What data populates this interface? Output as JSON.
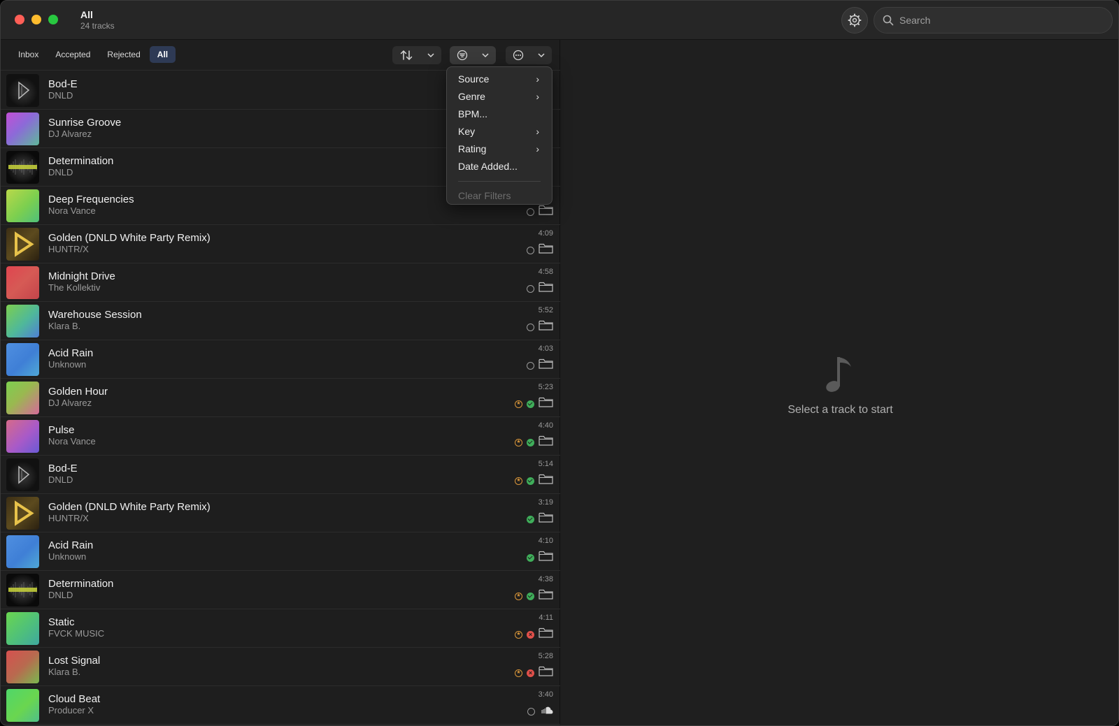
{
  "window": {
    "title": "All",
    "subtitle": "24 tracks"
  },
  "search": {
    "placeholder": "Search"
  },
  "tabs": [
    {
      "label": "Inbox",
      "active": false
    },
    {
      "label": "Accepted",
      "active": false
    },
    {
      "label": "Rejected",
      "active": false
    },
    {
      "label": "All",
      "active": true
    }
  ],
  "filter_menu": {
    "items": [
      {
        "label": "Source",
        "submenu": true
      },
      {
        "label": "Genre",
        "submenu": true
      },
      {
        "label": "BPM...",
        "submenu": false
      },
      {
        "label": "Key",
        "submenu": true
      },
      {
        "label": "Rating",
        "submenu": true
      },
      {
        "label": "Date Added...",
        "submenu": false
      }
    ],
    "clear_label": "Clear Filters"
  },
  "tracks": [
    {
      "title": "Bod-E",
      "artist": "DNLD",
      "duration": "",
      "art": "bode",
      "icons": []
    },
    {
      "title": "Sunrise Groove",
      "artist": "DJ Alvarez",
      "duration": "",
      "art": "purple",
      "icons": []
    },
    {
      "title": "Determination",
      "artist": "DNLD",
      "duration": "",
      "art": "determination",
      "icons": []
    },
    {
      "title": "Deep Frequencies",
      "artist": "Nora Vance",
      "duration": "",
      "art": "lime",
      "icons": [
        "empty",
        "folder"
      ]
    },
    {
      "title": "Golden (DNLD White Party Remix)",
      "artist": "HUNTR/X",
      "duration": "4:09",
      "art": "golden",
      "icons": [
        "empty",
        "folder"
      ]
    },
    {
      "title": "Midnight Drive",
      "artist": "The Kollektiv",
      "duration": "4:58",
      "art": "red",
      "icons": [
        "empty",
        "folder"
      ]
    },
    {
      "title": "Warehouse Session",
      "artist": "Klara B.",
      "duration": "5:52",
      "art": "greenblue",
      "icons": [
        "empty",
        "folder"
      ]
    },
    {
      "title": "Acid Rain",
      "artist": "Unknown",
      "duration": "4:03",
      "art": "blue",
      "icons": [
        "empty",
        "folder"
      ]
    },
    {
      "title": "Golden Hour",
      "artist": "DJ Alvarez",
      "duration": "5:23",
      "art": "greenpink",
      "icons": [
        "star",
        "check",
        "folder"
      ]
    },
    {
      "title": "Pulse",
      "artist": "Nora Vance",
      "duration": "4:40",
      "art": "pinkpurple",
      "icons": [
        "star",
        "check",
        "folder"
      ]
    },
    {
      "title": "Bod-E",
      "artist": "DNLD",
      "duration": "5:14",
      "art": "bode",
      "icons": [
        "star",
        "check",
        "folder"
      ]
    },
    {
      "title": "Golden (DNLD White Party Remix)",
      "artist": "HUNTR/X",
      "duration": "3:19",
      "art": "golden",
      "icons": [
        "check",
        "folder"
      ]
    },
    {
      "title": "Acid Rain",
      "artist": "Unknown",
      "duration": "4:10",
      "art": "blue",
      "icons": [
        "check",
        "folder"
      ]
    },
    {
      "title": "Determination",
      "artist": "DNLD",
      "duration": "4:38",
      "art": "determination",
      "icons": [
        "star",
        "check",
        "folder"
      ]
    },
    {
      "title": "Static",
      "artist": "FVCK MUSIC",
      "duration": "4:11",
      "art": "green",
      "icons": [
        "star",
        "x",
        "folder"
      ]
    },
    {
      "title": "Lost Signal",
      "artist": "Klara B.",
      "duration": "5:28",
      "art": "redgreen",
      "icons": [
        "star",
        "x",
        "folder"
      ]
    },
    {
      "title": "Cloud Beat",
      "artist": "Producer X",
      "duration": "3:40",
      "art": "brightgreen",
      "icons": [
        "empty",
        "cloud"
      ]
    }
  ],
  "detail": {
    "empty_text": "Select a track to start",
    "icon": "music-note-icon"
  },
  "colors": {
    "accent": "#2e3a55",
    "accepted": "#3fae5a",
    "rejected": "#e0504a",
    "starred": "#d9963a"
  }
}
